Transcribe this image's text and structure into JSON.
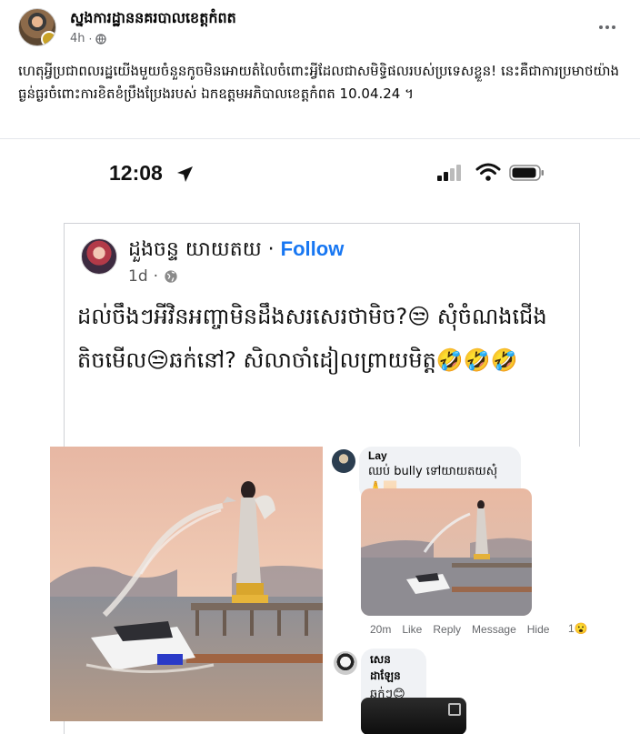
{
  "post": {
    "page_name": "ស្នងការដ្ឋាននគរបាលខេត្តកំពត",
    "time": "4h",
    "dot": "·",
    "caption": "ហេតុអ្វីប្រជាពលរដ្ឋយើងមួយចំនួនកូចមិនអោយតំលៃចំពោះអ្វីដែលជាសមិទ្ធិផលរបស់ប្រទេសខ្លួន! នេះគឺជាការប្រមាថយ៉ាងធ្ងន់ធ្ងរចំពោះការខិតខំប្រឹងប្រែងរបស់ ឯកឧត្តមអភិបាលខេត្តកំពត 10.04.24 ។"
  },
  "screenshot": {
    "status_time": "12:08",
    "fb_post": {
      "author": "ដួងចន្ទ យាយតយ",
      "dot": "·",
      "follow_label": "Follow",
      "time": "1d",
      "dot2": "·",
      "text": "ដល់ចឹងៗអីវិនអញ្ចាមិនដឹងសរសេរថាមិច?😒 សុំចំណងជើងតិចមើល😒ឆក់នៅ? សិលាចាំដៀលព្រាយមិត្ត🤣🤣🤣"
    },
    "comments": [
      {
        "author": "Lay",
        "text": "ឈប់ bully ទៅយាយតយសុំ🙏🏻",
        "time": "20m",
        "actions": [
          "Like",
          "Reply",
          "Message",
          "Hide"
        ],
        "reaction_count": "1😮"
      },
      {
        "author": "សេន ដាឡែន",
        "text": "ឆក់ៗ😊😊"
      }
    ]
  },
  "colors": {
    "accent": "#1877f2",
    "secondary_text": "#65676b",
    "comment_bubble": "#f0f2f5"
  },
  "icons": [
    "globe-icon",
    "more-options-icon",
    "location-arrow-icon",
    "signal-icon",
    "wifi-icon",
    "battery-icon"
  ]
}
